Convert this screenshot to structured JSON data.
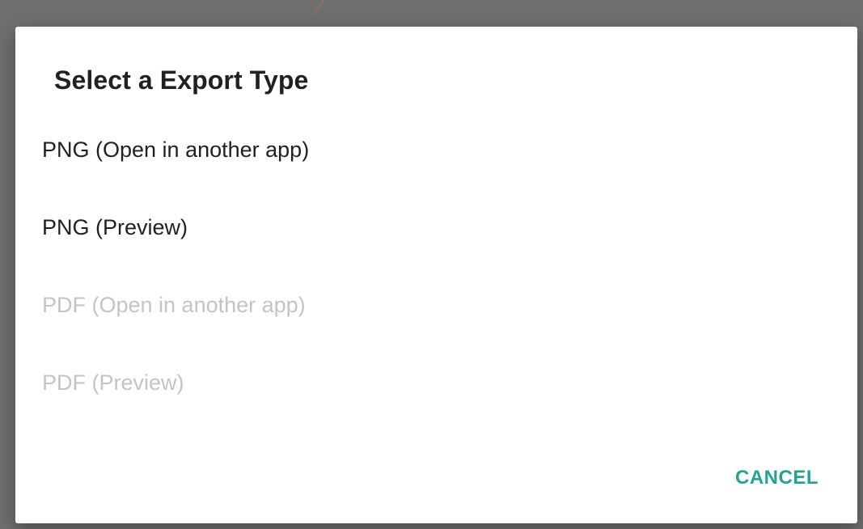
{
  "dialog": {
    "title": "Select a Export Type",
    "options": [
      {
        "label": "PNG (Open in another app)",
        "enabled": true
      },
      {
        "label": "PNG (Preview)",
        "enabled": true
      },
      {
        "label": "PDF (Open in another app)",
        "enabled": false
      },
      {
        "label": "PDF (Preview)",
        "enabled": false
      }
    ],
    "cancel_label": "CANCEL"
  },
  "colors": {
    "accent": "#26a196",
    "text_primary": "#212121",
    "text_disabled": "#c4c4c4",
    "scrim": "#6f6f6f"
  }
}
